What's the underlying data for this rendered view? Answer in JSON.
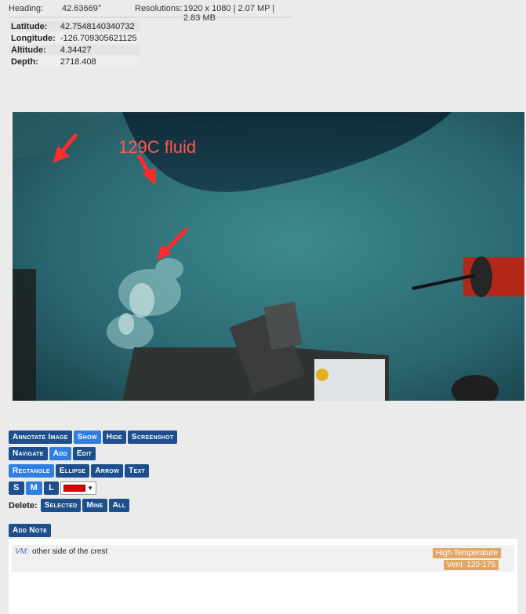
{
  "metadata": {
    "heading_label": "Heading:",
    "heading_value": "42.63669°",
    "resolutions_label": "Resolutions:",
    "resolutions_value": "1920 x 1080 | 2.07 MP | 2.83 MB",
    "rows": [
      {
        "label": "Latitude:",
        "value": "42.7548140340732"
      },
      {
        "label": "Longitude:",
        "value": "-126.709305621125"
      },
      {
        "label": "Altitude:",
        "value": "4.34427"
      },
      {
        "label": "Depth:",
        "value": "2718.408"
      }
    ]
  },
  "image": {
    "annotation_text": "129C fluid",
    "annotation_color": "#ff5a4e"
  },
  "toolbar": {
    "annotate_label": "Annotate Image",
    "show_label": "Show",
    "hide_label": "Hide",
    "screenshot_label": "Screenshot",
    "navigate_label": "Navigate",
    "add_label": "Add",
    "edit_label": "Edit",
    "rectangle_label": "Rectangle",
    "ellipse_label": "Ellipse",
    "arrow_label": "Arrow",
    "text_label": "Text",
    "size_s": "S",
    "size_m": "M",
    "size_l": "L",
    "selected_color": "#e00000",
    "delete_label": "Delete:",
    "delete_selected": "Selected",
    "delete_mine": "Mine",
    "delete_all": "All"
  },
  "notes": {
    "add_note_label": "Add Note",
    "items": [
      {
        "author": "VM:",
        "text": "other side of the crest",
        "tags": [
          "High Temperature",
          "Vent",
          "120-175"
        ]
      }
    ]
  },
  "colors": {
    "button": "#1d4f8c",
    "button_active": "#2f7fe0",
    "tag": "#e0a767"
  }
}
